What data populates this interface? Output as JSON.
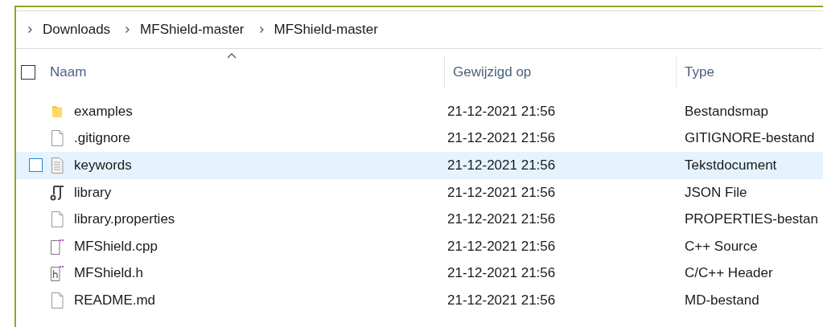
{
  "select_all_checked": false,
  "breadcrumb": [
    "Downloads",
    "MFShield-master",
    "MFShield-master"
  ],
  "columns": [
    {
      "label": "Naam",
      "sorted": true
    },
    {
      "label": "Gewijzigd op",
      "sorted": false
    },
    {
      "label": "Type",
      "sorted": false
    }
  ],
  "rows": [
    {
      "kind": "folder",
      "name": "examples",
      "modified": "21-12-2021 21:56",
      "type": "Bestandsmap",
      "hovered": false
    },
    {
      "kind": "file",
      "name": ".gitignore",
      "modified": "21-12-2021 21:56",
      "type": "GITIGNORE-bestand",
      "hovered": false
    },
    {
      "kind": "text",
      "name": "keywords",
      "modified": "21-12-2021 21:56",
      "type": "Tekstdocument",
      "hovered": true
    },
    {
      "kind": "json",
      "name": "library",
      "modified": "21-12-2021 21:56",
      "type": "JSON File",
      "hovered": false
    },
    {
      "kind": "file",
      "name": "library.properties",
      "modified": "21-12-2021 21:56",
      "type": "PROPERTIES-bestan",
      "hovered": false
    },
    {
      "kind": "cpp",
      "name": "MFShield.cpp",
      "modified": "21-12-2021 21:56",
      "type": "C++ Source",
      "hovered": false
    },
    {
      "kind": "h",
      "name": "MFShield.h",
      "modified": "21-12-2021 21:56",
      "type": "C/C++ Header",
      "hovered": false
    },
    {
      "kind": "file",
      "name": "README.md",
      "modified": "21-12-2021 21:56",
      "type": "MD-bestand",
      "hovered": false
    }
  ]
}
